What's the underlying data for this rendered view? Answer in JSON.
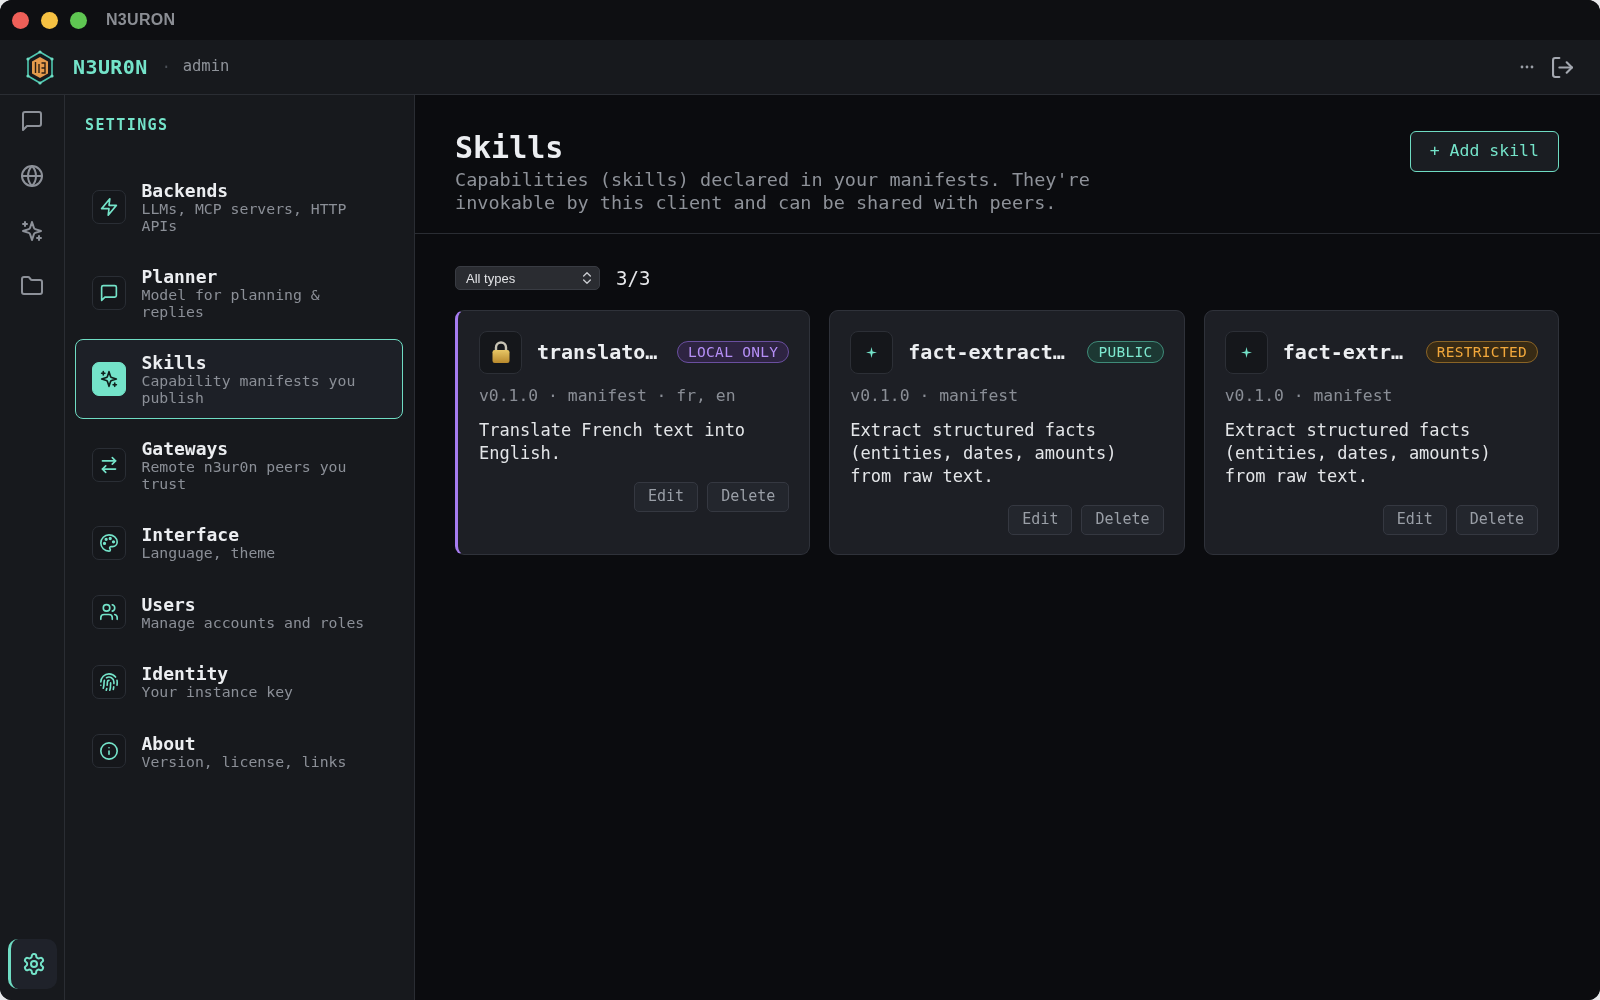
{
  "window": {
    "title": "N3URON"
  },
  "header": {
    "brand": "N3UR0N",
    "separator": "·",
    "user": "admin"
  },
  "nav_rail": {
    "top_items": [
      {
        "selected": false
      },
      {
        "selected": false
      },
      {
        "selected": false
      },
      {
        "selected": false
      }
    ],
    "bottom_items": [
      {
        "selected": true
      }
    ]
  },
  "settings_sidebar": {
    "heading": "SETTINGS",
    "items": [
      {
        "title": "Backends",
        "description": "LLMs, MCP servers, HTTP APIs",
        "selected": false
      },
      {
        "title": "Planner",
        "description": "Model for planning & replies",
        "selected": false
      },
      {
        "title": "Skills",
        "description": "Capability manifests you publish",
        "selected": true
      },
      {
        "title": "Gateways",
        "description": "Remote n3ur0n peers you trust",
        "selected": false
      },
      {
        "title": "Interface",
        "description": "Language, theme",
        "selected": false
      },
      {
        "title": "Users",
        "description": "Manage accounts and roles",
        "selected": false
      },
      {
        "title": "Identity",
        "description": "Your instance key",
        "selected": false
      },
      {
        "title": "About",
        "description": "Version, license, links",
        "selected": false
      }
    ]
  },
  "page": {
    "title": "Skills",
    "description": "Capabilities (skills) declared in your manifests. They're invokable by this client and can be shared with peers.",
    "add_button": "+ Add skill"
  },
  "filter": {
    "type_select": {
      "value": "All types"
    },
    "count": "3/3"
  },
  "skills": [
    {
      "kind": "local_only",
      "name": "translato…",
      "badge": "LOCAL ONLY",
      "meta": "v0.1.0 · manifest · fr, en",
      "description": "Translate French text into English.",
      "actions": [
        "Edit",
        "Delete"
      ]
    },
    {
      "kind": "public",
      "name": "fact-extract…",
      "badge": "PUBLIC",
      "meta": "v0.1.0 · manifest",
      "description": "Extract structured facts (entities, dates, amounts) from raw text.",
      "actions": [
        "Edit",
        "Delete"
      ]
    },
    {
      "kind": "restricted",
      "name": "fact-extr…",
      "badge": "RESTRICTED",
      "meta": "v0.1.0 · manifest",
      "description": "Extract structured facts (entities, dates, amounts) from raw text.",
      "actions": [
        "Edit",
        "Delete"
      ]
    }
  ]
}
